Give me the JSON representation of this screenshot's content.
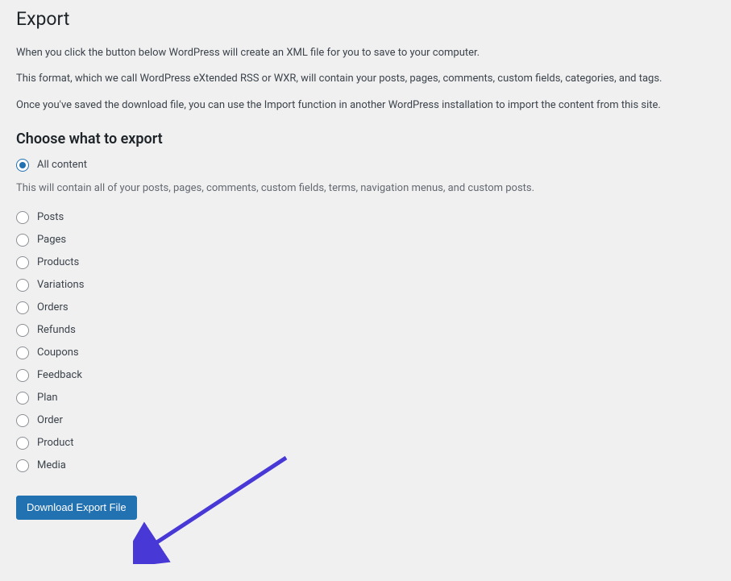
{
  "page": {
    "title": "Export",
    "intro1": "When you click the button below WordPress will create an XML file for you to save to your computer.",
    "intro2": "This format, which we call WordPress eXtended RSS or WXR, will contain your posts, pages, comments, custom fields, categories, and tags.",
    "intro3": "Once you've saved the download file, you can use the Import function in another WordPress installation to import the content from this site."
  },
  "section": {
    "heading": "Choose what to export",
    "all_content_description": "This will contain all of your posts, pages, comments, custom fields, terms, navigation menus, and custom posts."
  },
  "options": {
    "all_content": "All content",
    "posts": "Posts",
    "pages": "Pages",
    "products": "Products",
    "variations": "Variations",
    "orders": "Orders",
    "refunds": "Refunds",
    "coupons": "Coupons",
    "feedback": "Feedback",
    "plan": "Plan",
    "order": "Order",
    "product": "Product",
    "media": "Media"
  },
  "selected_option": "all_content",
  "button": {
    "download": "Download Export File"
  },
  "annotation": {
    "arrow_color": "#4838d6"
  }
}
